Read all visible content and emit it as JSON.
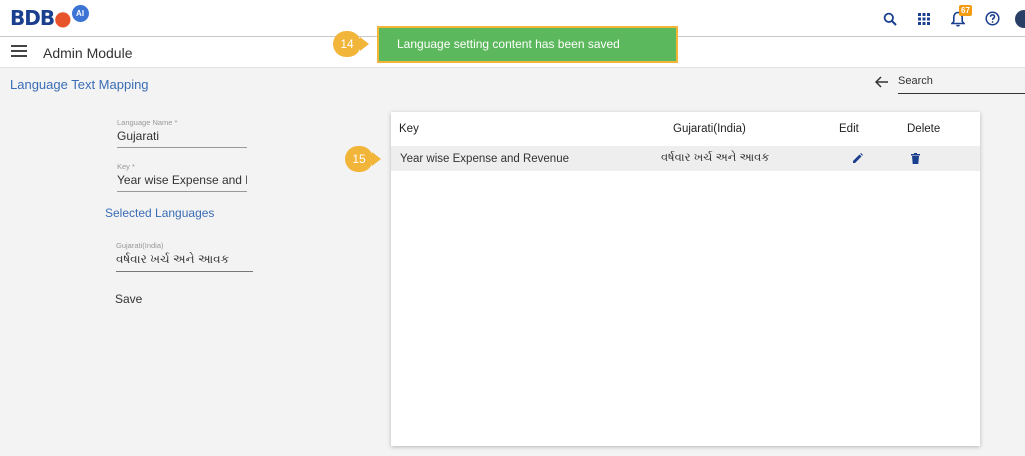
{
  "app": {
    "logo_letters": "BDB",
    "logo_ai": "AI",
    "notification_count": "67"
  },
  "icons": {
    "search": "search-icon",
    "apps": "apps-grid-icon",
    "notifications": "bell-icon",
    "help": "help-icon",
    "menu": "hamburger-icon",
    "back": "arrow-left-icon",
    "edit": "pencil-icon",
    "delete": "trash-icon"
  },
  "header": {
    "module_title": "Admin Module"
  },
  "page": {
    "title": "Language Text Mapping",
    "search_placeholder": "Search"
  },
  "form": {
    "language_name_label": "Language Name *",
    "language_name_value": "Gujarati",
    "key_label": "Key *",
    "key_value": "Year wise Expense and Revenue",
    "selected_languages_heading": "Selected Languages",
    "translation_label": "Gujarati(India)",
    "translation_value": "વર્ષવાર ખર્ચ અને આવક",
    "save_label": "Save"
  },
  "table": {
    "columns": [
      "Key",
      "Gujarati(India)",
      "Edit",
      "Delete"
    ],
    "rows": [
      {
        "key": "Year wise Expense and Revenue",
        "translation": "વર્ષવાર ખર્ચ અને આવક"
      }
    ]
  },
  "toast": {
    "message": "Language setting content has been saved"
  },
  "steps": {
    "toast_step": "14",
    "row_step": "15"
  },
  "colors": {
    "accent": "#3a6db6",
    "toast_bg": "#5cb85c",
    "step_marker": "#f1b53a",
    "badge": "#f39c12"
  }
}
